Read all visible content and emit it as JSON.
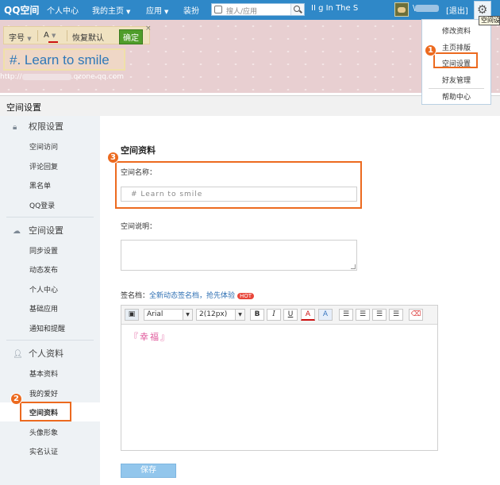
{
  "topbar": {
    "logo": "QQ空间",
    "nav": [
      "个人中心",
      "我的主页",
      "应用",
      "装扮"
    ],
    "search_placeholder": "搜人/应用",
    "music_text": "II  g In The S",
    "username_prefix": "\\",
    "logout": "[退出]",
    "gear_tooltip": "空间设"
  },
  "settings_menu": [
    "修改资料",
    "主页排版",
    "空间设置",
    "好友管理",
    "帮助中心"
  ],
  "banner": {
    "toolbar": {
      "font_size": "字号",
      "font_color": "A",
      "reset": "恢复默认",
      "confirm": "确定",
      "close": "×"
    },
    "title": "#. Learn to smile",
    "url_prefix": "http://",
    "url_suffix": ".qzone.qq.com"
  },
  "page_header": "空间设置",
  "sidebar": {
    "sections": [
      {
        "title": "权限设置",
        "icon": "lock-icon",
        "items": [
          "空间访问",
          "评论回复",
          "黑名单",
          "QQ登录"
        ]
      },
      {
        "title": "空间设置",
        "icon": "cloud-icon",
        "items": [
          "同步设置",
          "动态发布",
          "个人中心",
          "基础应用",
          "通知和提醒"
        ]
      },
      {
        "title": "个人资料",
        "icon": "user-icon",
        "items": [
          "基本资料",
          "我的爱好",
          "空间资料",
          "头像形象",
          "实名认证"
        ]
      }
    ]
  },
  "form": {
    "title": "空间资料",
    "name_label": "空间名称：",
    "name_value": "#  Learn  to  smile",
    "desc_label": "空间说明：",
    "signature_label": "签名档：",
    "signature_link": "全新动态签名档，抢先体验",
    "hot_badge": "HOT",
    "editor": {
      "font": "Arial",
      "size": "2(12px)",
      "bold": "B",
      "italic": "I",
      "underline": "U",
      "color": "A",
      "bgcolor": "A"
    },
    "signature_content": "『幸福』",
    "save": "保存"
  },
  "annotations": [
    "1",
    "2",
    "3"
  ],
  "colors": {
    "accent": "#2f88c8",
    "callout": "#ec6a1f",
    "confirm": "#4f9d2a",
    "signature": "#e05a9c"
  }
}
